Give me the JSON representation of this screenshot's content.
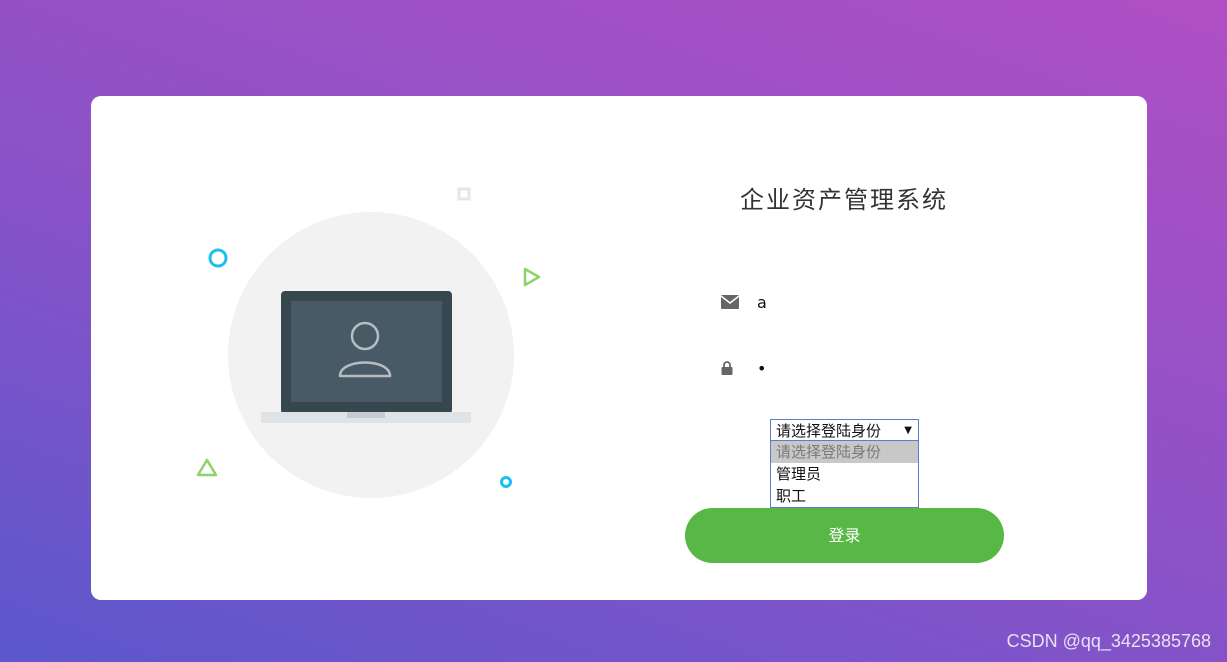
{
  "app": {
    "title": "企业资产管理系统"
  },
  "form": {
    "username_value": "a",
    "password_value": "•",
    "role_select": {
      "selected": "请选择登陆身份",
      "options": [
        "请选择登陆身份",
        "管理员",
        "职工"
      ]
    },
    "login_label": "登录"
  },
  "icons": {
    "email": "envelope-icon",
    "password": "lock-icon",
    "select_arrow": "dropdown-arrow-icon"
  },
  "colors": {
    "login_button": "#57b846",
    "accent_blue": "#1cc0ef",
    "accent_green": "#8cd36c"
  },
  "watermark": "CSDN @qq_3425385768"
}
